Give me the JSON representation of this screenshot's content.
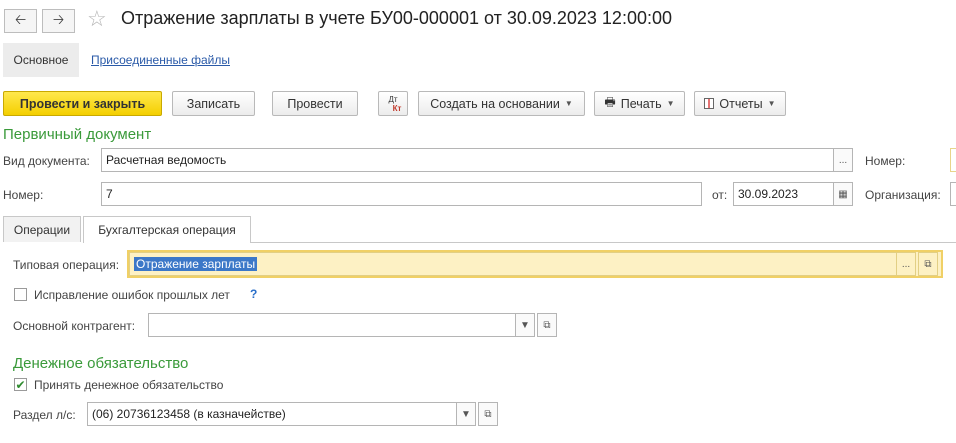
{
  "header": {
    "title": "Отражение зарплаты в учете БУ00-000001 от 30.09.2023 12:00:00",
    "back_icon": "arrow-left-icon",
    "forward_icon": "arrow-right-icon",
    "favorite_icon": "star-icon"
  },
  "form_tabs": {
    "main": "Основное",
    "files": "Присоединенные файлы"
  },
  "toolbar": {
    "post_close": "Провести и закрыть",
    "save": "Записать",
    "post": "Провести",
    "dt_kt": "Дт",
    "dt_kt_sub": "Кт",
    "create_based": "Создать на основании",
    "print": "Печать",
    "reports": "Отчеты"
  },
  "primary_doc": {
    "section_title": "Первичный документ",
    "doc_type_label": "Вид документа:",
    "doc_type_value": "Расчетная ведомость",
    "number_label": "Номер:",
    "number_value": "7",
    "date_label": "от:",
    "date_value": "30.09.2023",
    "right_number_label": "Номер:",
    "organization_label": "Организация:"
  },
  "inner_tabs": {
    "operations": "Операции",
    "accounting": "Бухгалтерская операция"
  },
  "accounting": {
    "typical_op_label": "Типовая операция:",
    "typical_op_value": "Отражение зарплаты",
    "fix_errors_label": "Исправление ошибок прошлых лет",
    "fix_errors_checked": false,
    "help_mark": "?",
    "counterparty_label": "Основной контрагент:",
    "counterparty_value": ""
  },
  "obligation": {
    "section_title": "Денежное обязательство",
    "accept_label": "Принять денежное обязательство",
    "accept_checked": true,
    "account_label": "Раздел л/с:",
    "account_value": "(06) 20736123458 (в казначействе)"
  },
  "colors": {
    "accent_green": "#3a9a3a",
    "primary_button": "#f4cf00",
    "link": "#2a5aa8"
  }
}
